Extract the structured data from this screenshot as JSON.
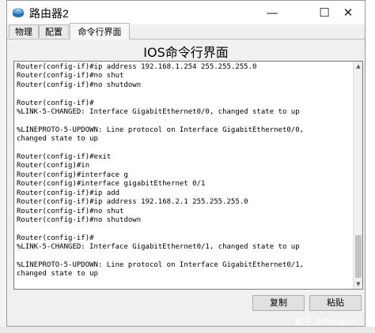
{
  "window": {
    "title": "路由器2",
    "controls": {
      "minimize": "—",
      "maximize": "☐",
      "close": "✕"
    }
  },
  "tabs": [
    {
      "label": "物理"
    },
    {
      "label": "配置"
    },
    {
      "label": "命令行界面",
      "active": true
    }
  ],
  "cli": {
    "header": "IOS命令行界面",
    "lines": [
      "Router(config-if)#ip address 192.168.1.254 255.255.255.0",
      "Router(config-if)#no shut",
      "Router(config-if)#no shutdown",
      "",
      "Router(config-if)#",
      "%LINK-5-CHANGED: Interface GigabitEthernet0/0, changed state to up",
      "",
      "%LINEPROTO-5-UPDOWN: Line protocol on Interface GigabitEthernet0/0,",
      "changed state to up",
      "",
      "Router(config-if)#exit",
      "Router(config)#in",
      "Router(config)#interface g",
      "Router(config)#interface gigabitEthernet 0/1",
      "Router(config-if)#ip add",
      "Router(config-if)#ip address 192.168.2.1 255.255.255.0",
      "Router(config-if)#no shut",
      "Router(config-if)#no shutdown",
      "",
      "Router(config-if)#",
      "%LINK-5-CHANGED: Interface GigabitEthernet0/1, changed state to up",
      "",
      "%LINEPROTO-5-UPDOWN: Line protocol on Interface GigabitEthernet0/1,",
      "changed state to up"
    ]
  },
  "buttons": {
    "copy": "复制",
    "paste": "粘贴"
  },
  "watermark": "知乎 @Penguin",
  "colors": {
    "terminal_bg": "#ffffff",
    "window_bg": "#f0f0f0",
    "button_bg": "#e1e1e1"
  }
}
